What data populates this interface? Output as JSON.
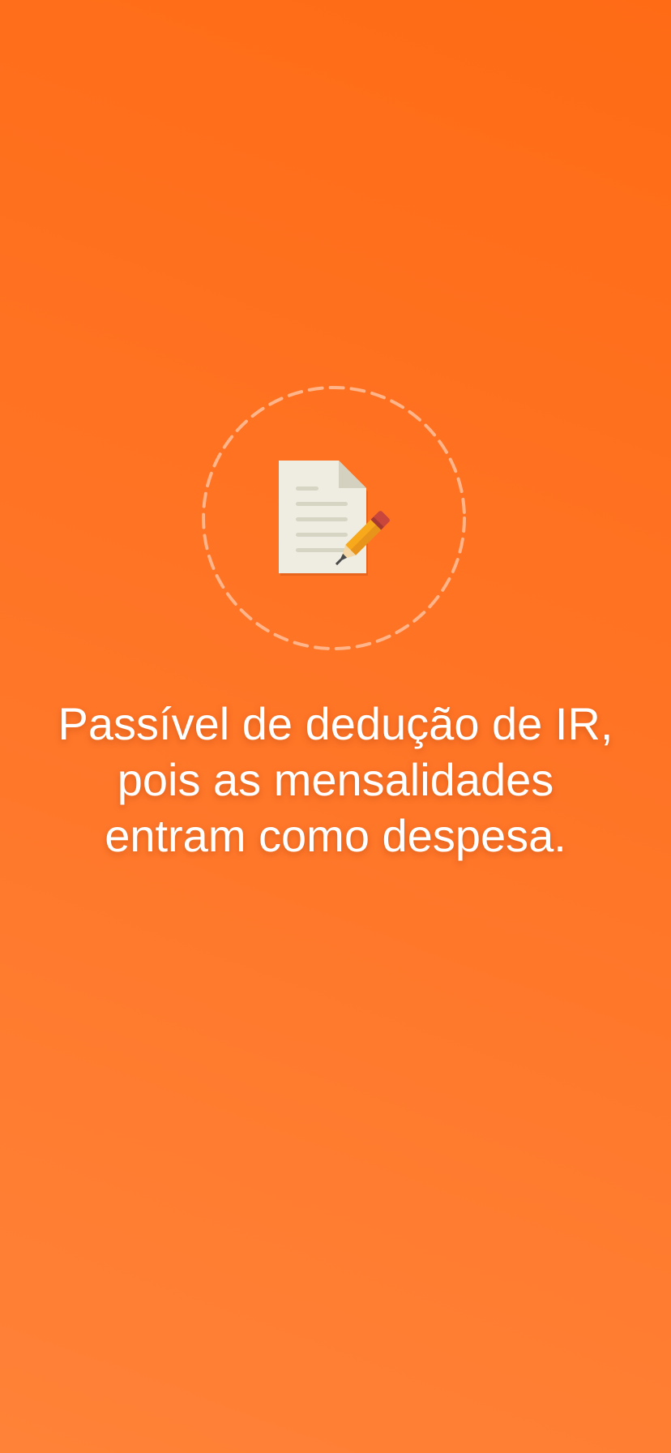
{
  "onboarding": {
    "illustration_icon": "document-with-pencil-icon",
    "message": "Passível de dedução de IR,\npois as mensalidades\nentram como despesa."
  },
  "colors": {
    "background_top": "#ff6b15",
    "background_bottom": "#ff8238",
    "dashed_ring": "#ffb48a",
    "paper": "#efece1",
    "paper_fold": "#d4d1c1",
    "paper_lines": "#d6d4c2",
    "pencil_body": "#f7a81b",
    "pencil_eraser": "#c8463b",
    "text": "#ffffff"
  }
}
